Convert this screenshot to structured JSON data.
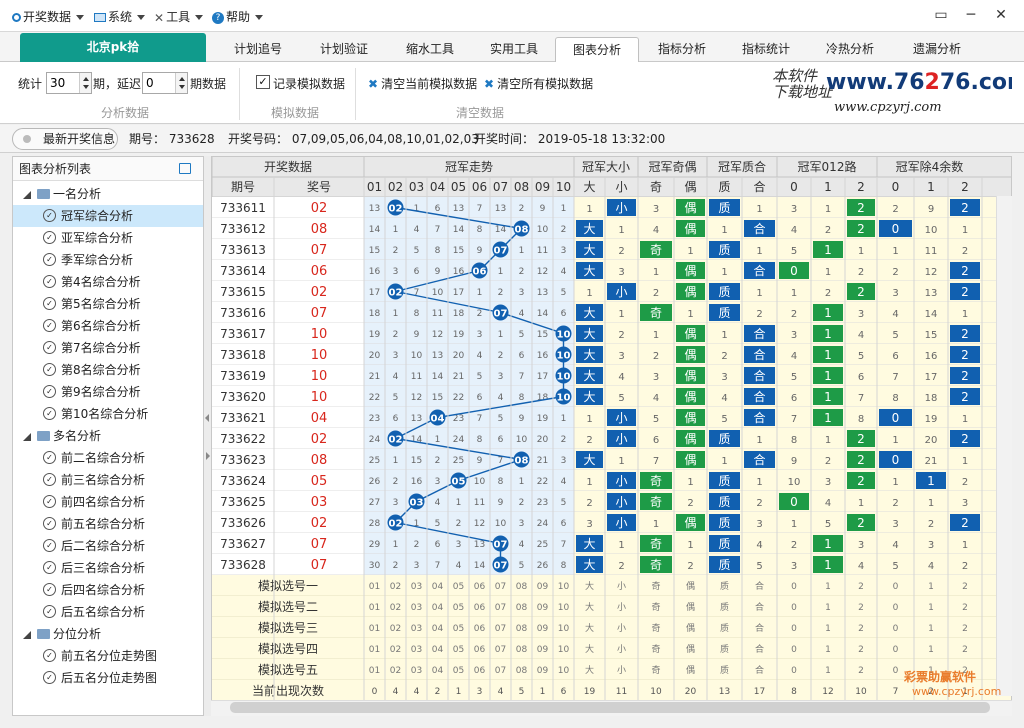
{
  "menu": {
    "items": [
      {
        "label": "开奖数据",
        "icon": "circle-icon"
      },
      {
        "label": "系统",
        "icon": "monitor-icon"
      },
      {
        "label": "工具",
        "icon": "tools-icon"
      },
      {
        "label": "帮助",
        "icon": "help-icon"
      }
    ],
    "window_controls": [
      "▭",
      "─",
      "✕"
    ]
  },
  "tabs": {
    "home": "北京pk拾",
    "items": [
      "计划追号",
      "计划验证",
      "缩水工具",
      "实用工具",
      "图表分析",
      "指标分析",
      "指标统计",
      "冷热分析",
      "遗漏分析"
    ],
    "active_index": 4
  },
  "toolbar": {
    "stat_label": "统计",
    "stat_value": "30",
    "period_label": "期，延迟",
    "delay_value": "0",
    "data_label": "期数据",
    "group1": "分析数据",
    "record_label": "记录模拟数据",
    "record_checked": "✓",
    "group2": "模拟数据",
    "clear_current": "清空当前模拟数据",
    "clear_all": "清空所有模拟数据",
    "group3": "清空数据"
  },
  "logo": {
    "cn1": "本软件",
    "cn2": "下载地址",
    "site_a": "www.76",
    "site_b": "2",
    "site_c": "76.com",
    "sub": "www.cpzyrj.com"
  },
  "info": {
    "button": "最新开奖信息",
    "period": "期号：  733628",
    "numbers": "开奖号码：  07,09,05,06,04,08,10,01,02,03",
    "time": "开奖时间：  2019-05-18 13:32:00"
  },
  "left": {
    "title": "图表分析列表",
    "groups": [
      {
        "label": "一名分析",
        "items": [
          "冠军综合分析",
          "亚军综合分析",
          "季军综合分析",
          "第4名综合分析",
          "第5名综合分析",
          "第6名综合分析",
          "第7名综合分析",
          "第8名综合分析",
          "第9名综合分析",
          "第10名综合分析"
        ]
      },
      {
        "label": "多名分析",
        "items": [
          "前二名综合分析",
          "前三名综合分析",
          "前四名综合分析",
          "前五名综合分析",
          "后二名综合分析",
          "后三名综合分析",
          "后四名综合分析",
          "后五名综合分析"
        ]
      },
      {
        "label": "分位分析",
        "items": [
          "前五名分位走势图",
          "后五名分位走势图"
        ]
      }
    ],
    "selected": "冠军综合分析"
  },
  "grid": {
    "head1": [
      "开奖数据",
      "冠军走势",
      "冠军大小",
      "冠军奇偶",
      "冠军质合",
      "冠军012路",
      "冠军除4余数"
    ],
    "col_period": "期号",
    "col_prize": "奖号",
    "nums": [
      "01",
      "02",
      "03",
      "04",
      "05",
      "06",
      "07",
      "08",
      "09",
      "10"
    ],
    "sub_dx": [
      "大",
      "小"
    ],
    "sub_jo": [
      "奇",
      "偶"
    ],
    "sub_zh": [
      "质",
      "合"
    ],
    "sub_012": [
      "0",
      "1",
      "2"
    ],
    "sub_r4": [
      "0",
      "1",
      "2"
    ],
    "rows": [
      {
        "p": "733611",
        "w": "02",
        "miss": [
          "13",
          "",
          "1",
          "6",
          "13",
          "7",
          "13",
          "2",
          "9",
          "1"
        ],
        "dx": [
          "1",
          "小"
        ],
        "jo": [
          "3",
          "偶"
        ],
        "zh": [
          "质",
          "1"
        ],
        "r3": [
          "3",
          "1",
          "2"
        ],
        "r4": [
          "2",
          "9",
          "2"
        ]
      },
      {
        "p": "733612",
        "w": "08",
        "miss": [
          "14",
          "1",
          "4",
          "7",
          "14",
          "8",
          "14",
          "",
          "10",
          "2"
        ],
        "dx": [
          "大",
          "1"
        ],
        "jo": [
          "4",
          "偶"
        ],
        "zh": [
          "1",
          "合"
        ],
        "r3": [
          "4",
          "2",
          "2"
        ],
        "r4": [
          "0",
          "10",
          "1"
        ]
      },
      {
        "p": "733613",
        "w": "07",
        "miss": [
          "15",
          "2",
          "5",
          "8",
          "15",
          "9",
          "",
          "1",
          "11",
          "3"
        ],
        "dx": [
          "大",
          "2"
        ],
        "jo": [
          "奇",
          "1"
        ],
        "zh": [
          "质",
          "1"
        ],
        "r3": [
          "5",
          "1",
          "1"
        ],
        "r4": [
          "1",
          "11",
          "2"
        ]
      },
      {
        "p": "733614",
        "w": "06",
        "miss": [
          "16",
          "3",
          "6",
          "9",
          "16",
          "",
          "1",
          "2",
          "12",
          "4"
        ],
        "dx": [
          "大",
          "3"
        ],
        "jo": [
          "1",
          "偶"
        ],
        "zh": [
          "1",
          "合"
        ],
        "r3": [
          "0",
          "1",
          "2"
        ],
        "r4": [
          "2",
          "12",
          "2"
        ]
      },
      {
        "p": "733615",
        "w": "02",
        "miss": [
          "17",
          "",
          "7",
          "10",
          "17",
          "1",
          "2",
          "3",
          "13",
          "5"
        ],
        "dx": [
          "1",
          "小"
        ],
        "jo": [
          "2",
          "偶"
        ],
        "zh": [
          "质",
          "1"
        ],
        "r3": [
          "1",
          "2",
          "2"
        ],
        "r4": [
          "3",
          "13",
          "2"
        ]
      },
      {
        "p": "733616",
        "w": "07",
        "miss": [
          "18",
          "1",
          "8",
          "11",
          "18",
          "2",
          "",
          "4",
          "14",
          "6"
        ],
        "dx": [
          "大",
          "1"
        ],
        "jo": [
          "奇",
          "1"
        ],
        "zh": [
          "质",
          "2"
        ],
        "r3": [
          "2",
          "1",
          "3"
        ],
        "r4": [
          "4",
          "14",
          "1"
        ]
      },
      {
        "p": "733617",
        "w": "10",
        "miss": [
          "19",
          "2",
          "9",
          "12",
          "19",
          "3",
          "1",
          "5",
          "15",
          ""
        ],
        "dx": [
          "大",
          "2"
        ],
        "jo": [
          "1",
          "偶"
        ],
        "zh": [
          "1",
          "合"
        ],
        "r3": [
          "3",
          "1",
          "4"
        ],
        "r4": [
          "5",
          "15",
          "2"
        ]
      },
      {
        "p": "733618",
        "w": "10",
        "miss": [
          "20",
          "3",
          "10",
          "13",
          "20",
          "4",
          "2",
          "6",
          "16",
          ""
        ],
        "dx": [
          "大",
          "3"
        ],
        "jo": [
          "2",
          "偶"
        ],
        "zh": [
          "2",
          "合"
        ],
        "r3": [
          "4",
          "1",
          "5"
        ],
        "r4": [
          "6",
          "16",
          "2"
        ]
      },
      {
        "p": "733619",
        "w": "10",
        "miss": [
          "21",
          "4",
          "11",
          "14",
          "21",
          "5",
          "3",
          "7",
          "17",
          ""
        ],
        "dx": [
          "大",
          "4"
        ],
        "jo": [
          "3",
          "偶"
        ],
        "zh": [
          "3",
          "合"
        ],
        "r3": [
          "5",
          "1",
          "6"
        ],
        "r4": [
          "7",
          "17",
          "2"
        ]
      },
      {
        "p": "733620",
        "w": "10",
        "miss": [
          "22",
          "5",
          "12",
          "15",
          "22",
          "6",
          "4",
          "8",
          "18",
          ""
        ],
        "dx": [
          "大",
          "5"
        ],
        "jo": [
          "4",
          "偶"
        ],
        "zh": [
          "4",
          "合"
        ],
        "r3": [
          "6",
          "1",
          "7"
        ],
        "r4": [
          "8",
          "18",
          "2"
        ]
      },
      {
        "p": "733621",
        "w": "04",
        "miss": [
          "23",
          "6",
          "13",
          "",
          "23",
          "7",
          "5",
          "9",
          "19",
          "1"
        ],
        "dx": [
          "1",
          "小"
        ],
        "jo": [
          "5",
          "偶"
        ],
        "zh": [
          "5",
          "合"
        ],
        "r3": [
          "7",
          "1",
          "8"
        ],
        "r4": [
          "0",
          "19",
          "1"
        ]
      },
      {
        "p": "733622",
        "w": "02",
        "miss": [
          "24",
          "",
          "14",
          "1",
          "24",
          "8",
          "6",
          "10",
          "20",
          "2"
        ],
        "dx": [
          "2",
          "小"
        ],
        "jo": [
          "6",
          "偶"
        ],
        "zh": [
          "质",
          "1"
        ],
        "r3": [
          "8",
          "1",
          "2"
        ],
        "r4": [
          "1",
          "20",
          "2"
        ]
      },
      {
        "p": "733623",
        "w": "08",
        "miss": [
          "25",
          "1",
          "15",
          "2",
          "25",
          "9",
          "7",
          "",
          "21",
          "3"
        ],
        "dx": [
          "大",
          "1"
        ],
        "jo": [
          "7",
          "偶"
        ],
        "zh": [
          "1",
          "合"
        ],
        "r3": [
          "9",
          "2",
          "2"
        ],
        "r4": [
          "0",
          "21",
          "1"
        ]
      },
      {
        "p": "733624",
        "w": "05",
        "miss": [
          "26",
          "2",
          "16",
          "3",
          "",
          "10",
          "8",
          "1",
          "22",
          "4"
        ],
        "dx": [
          "1",
          "小"
        ],
        "jo": [
          "奇",
          "1"
        ],
        "zh": [
          "质",
          "1"
        ],
        "r3": [
          "10",
          "3",
          "2"
        ],
        "r4": [
          "1",
          "1",
          "2"
        ]
      },
      {
        "p": "733625",
        "w": "03",
        "miss": [
          "27",
          "3",
          "",
          "4",
          "1",
          "11",
          "9",
          "2",
          "23",
          "5"
        ],
        "dx": [
          "2",
          "小"
        ],
        "jo": [
          "奇",
          "2"
        ],
        "zh": [
          "质",
          "2"
        ],
        "r3": [
          "0",
          "4",
          "1"
        ],
        "r4": [
          "2",
          "1",
          "3"
        ]
      },
      {
        "p": "733626",
        "w": "02",
        "miss": [
          "28",
          "",
          "1",
          "5",
          "2",
          "12",
          "10",
          "3",
          "24",
          "6"
        ],
        "dx": [
          "3",
          "小"
        ],
        "jo": [
          "1",
          "偶"
        ],
        "zh": [
          "质",
          "3"
        ],
        "r3": [
          "1",
          "5",
          "2"
        ],
        "r4": [
          "3",
          "2",
          "2"
        ]
      },
      {
        "p": "733627",
        "w": "07",
        "miss": [
          "29",
          "1",
          "2",
          "6",
          "3",
          "13",
          "",
          "4",
          "25",
          "7"
        ],
        "dx": [
          "大",
          "1"
        ],
        "jo": [
          "奇",
          "1"
        ],
        "zh": [
          "质",
          "4"
        ],
        "r3": [
          "2",
          "1",
          "3"
        ],
        "r4": [
          "4",
          "3",
          "1"
        ]
      },
      {
        "p": "733628",
        "w": "07",
        "miss": [
          "30",
          "2",
          "3",
          "7",
          "4",
          "14",
          "",
          "5",
          "26",
          "8"
        ],
        "dx": [
          "大",
          "2"
        ],
        "jo": [
          "奇",
          "2"
        ],
        "zh": [
          "质",
          "5"
        ],
        "r3": [
          "3",
          "1",
          "4"
        ],
        "r4": [
          "5",
          "4",
          "2"
        ]
      }
    ],
    "sim_rows": [
      "模拟选号一",
      "模拟选号二",
      "模拟选号三",
      "模拟选号四",
      "模拟选号五"
    ],
    "sim_values": [
      "01",
      "02",
      "03",
      "04",
      "05",
      "06",
      "07",
      "08",
      "09",
      "10",
      "大",
      "小",
      "奇",
      "偶",
      "质",
      "合",
      "0",
      "1",
      "2",
      "0",
      "1",
      "2"
    ],
    "count_label": "当前出现次数",
    "count_values": [
      "0",
      "4",
      "4",
      "2",
      "1",
      "3",
      "4",
      "5",
      "1",
      "6",
      "19",
      "11",
      "10",
      "20",
      "13",
      "17",
      "8",
      "12",
      "10",
      "7",
      "2",
      "1"
    ]
  },
  "watermark": {
    "line1": "彩票助赢软件",
    "line2": "www.cpzyrj.com"
  },
  "colors": {
    "teal": "#109b8c",
    "blue": "#1160b0",
    "green": "#1e9b47",
    "select": "#cce8fb",
    "header": "#e8e8e8",
    "yellow": "#fffbe0",
    "lightblue": "#e6f1fb",
    "red": "#d8261c"
  }
}
